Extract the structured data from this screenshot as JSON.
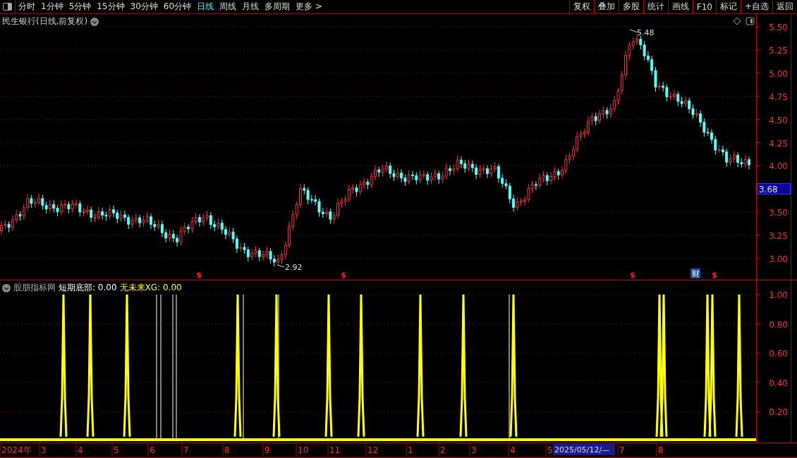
{
  "toolbar": {
    "periods": [
      {
        "label": "分时",
        "selected": false
      },
      {
        "label": "1分钟",
        "selected": false
      },
      {
        "label": "5分钟",
        "selected": false
      },
      {
        "label": "15分钟",
        "selected": false
      },
      {
        "label": "30分钟",
        "selected": false
      },
      {
        "label": "60分钟",
        "selected": false
      },
      {
        "label": "日线",
        "selected": true
      },
      {
        "label": "周线",
        "selected": false
      },
      {
        "label": "月线",
        "selected": false
      },
      {
        "label": "多周期",
        "selected": false
      },
      {
        "label": "更多 >",
        "selected": false
      }
    ],
    "buttons": [
      "复权",
      "叠加",
      "多股",
      "统计",
      "画线",
      "F10",
      "标记",
      "+自选",
      "返回"
    ]
  },
  "main_chart": {
    "title": "民生银行(日线,前复权)",
    "y_labels": [
      "5.50",
      "5.25",
      "5.00",
      "4.75",
      "4.50",
      "4.25",
      "4.00",
      "3.50",
      "3.25",
      "3.00"
    ],
    "current_price": "3.68",
    "high_label": "5.48",
    "low_label": "2.92",
    "markers": [
      {
        "kind": "dollar",
        "label": "$"
      },
      {
        "kind": "dollar",
        "label": "$"
      },
      {
        "kind": "dollar",
        "label": "$"
      },
      {
        "kind": "note",
        "label": "财"
      },
      {
        "kind": "dollar",
        "label": "$"
      }
    ]
  },
  "indicator": {
    "name": "股朋指标网",
    "fields": [
      {
        "label": "短期底部: 0.00",
        "color": "#ffffff"
      },
      {
        "label": "无未来XG: 0.00",
        "color": "#ffff00"
      }
    ],
    "y_labels": [
      "1.00",
      "0.80",
      "0.60",
      "0.40",
      "0.20"
    ]
  },
  "date_axis": {
    "labels": [
      "2024年",
      "3",
      "4",
      "5",
      "6",
      "7",
      "8",
      "9",
      "10",
      "11",
      "12",
      "1",
      "2",
      "3",
      "4",
      "5",
      "7",
      "8"
    ],
    "cursor_date": "2025/05/12/—"
  }
}
